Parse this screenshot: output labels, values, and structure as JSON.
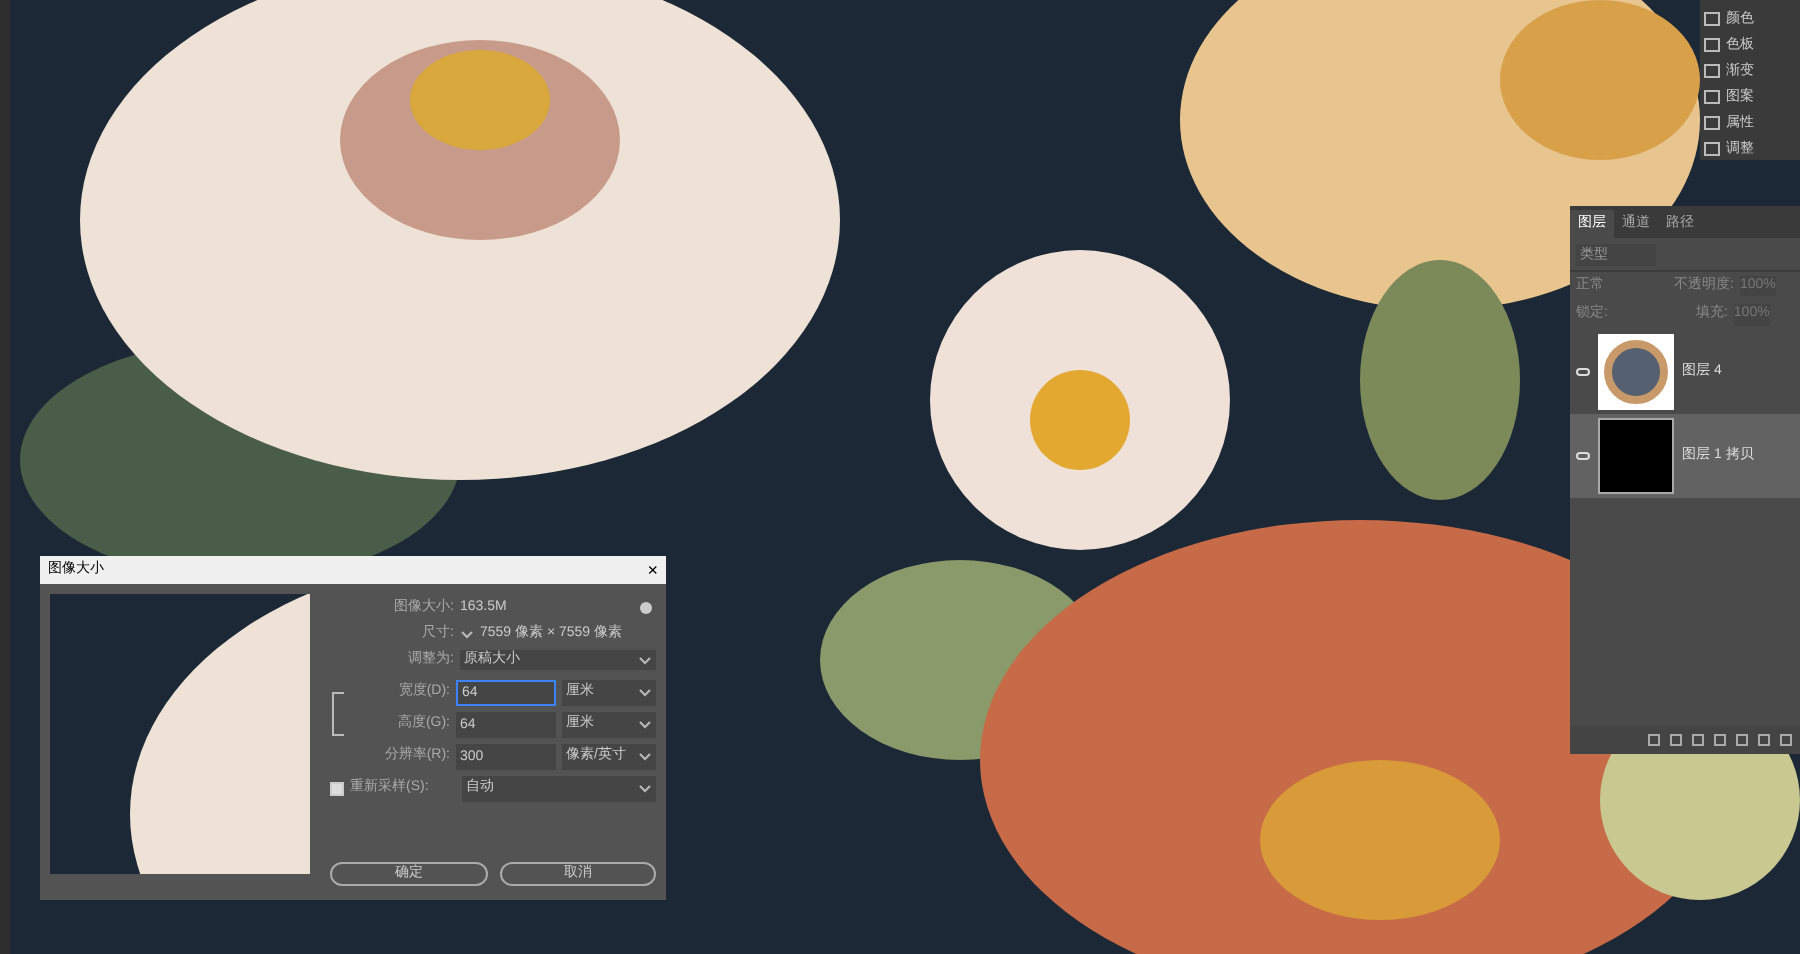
{
  "right_dock": {
    "items": [
      {
        "label": "颜色"
      },
      {
        "label": "色板"
      },
      {
        "label": "渐变"
      },
      {
        "label": "图案"
      },
      {
        "label": "属性"
      },
      {
        "label": "调整"
      }
    ]
  },
  "layers_panel": {
    "tabs": [
      {
        "label": "图层",
        "selected": true
      },
      {
        "label": "通道",
        "selected": false
      },
      {
        "label": "路径",
        "selected": false
      }
    ],
    "search": {
      "placeholder": "类型"
    },
    "blend_mode": "正常",
    "opacity_label": "不透明度:",
    "opacity": "100%",
    "lock_label": "锁定:",
    "fill_label": "填充:",
    "fill": "100%",
    "layers": [
      {
        "name": "图层 4",
        "kind": "pattern",
        "visible": true,
        "selected": false
      },
      {
        "name": "图层 1 拷贝",
        "kind": "black",
        "visible": true,
        "selected": true
      }
    ]
  },
  "dialog": {
    "title": "图像大小",
    "close": "×",
    "image_size_label": "图像大小:",
    "image_size": "163.5M",
    "dimensions_label": "尺寸:",
    "dimensions": "7559 像素 × 7559 像素",
    "fit_label": "调整为:",
    "fit": "原稿大小",
    "fields": [
      {
        "label": "宽度(D):",
        "value": "64",
        "unit": "厘米",
        "focused": true
      },
      {
        "label": "高度(G):",
        "value": "64",
        "unit": "厘米",
        "focused": false
      },
      {
        "label": "分辨率(R):",
        "value": "300",
        "unit": "像素/英寸",
        "focused": false
      }
    ],
    "resample": {
      "label": "重新采样(S):",
      "checked": true,
      "value": "自动"
    },
    "buttons": [
      "确定",
      "取消"
    ]
  }
}
